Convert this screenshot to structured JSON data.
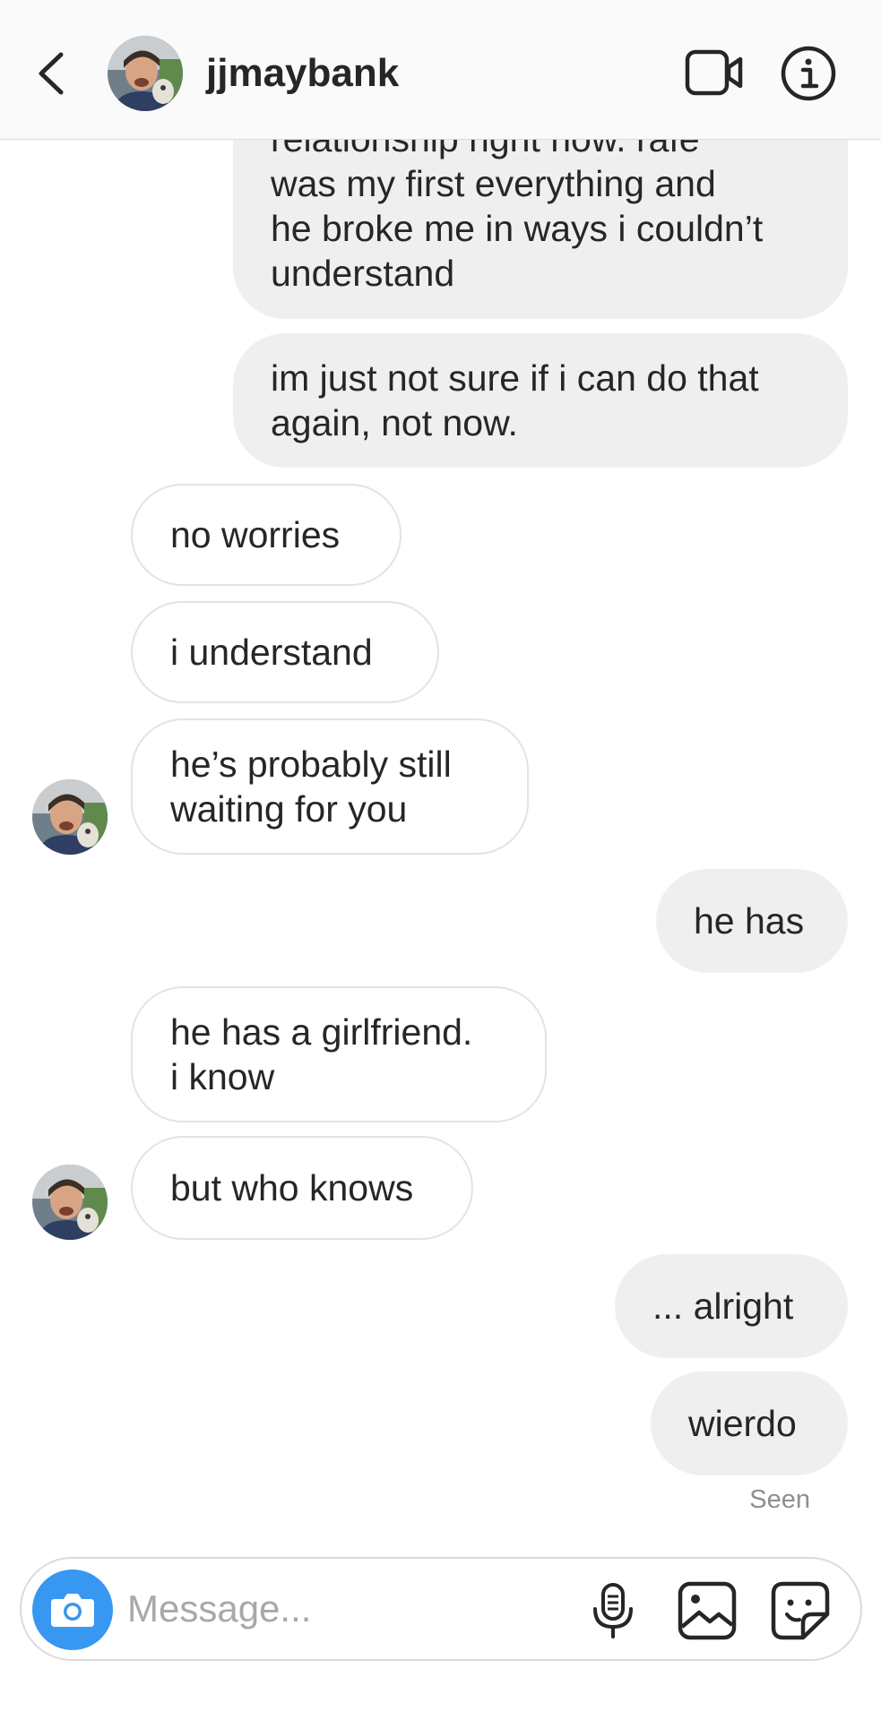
{
  "header": {
    "username": "jjmaybank",
    "icons": [
      "chevron-left-icon",
      "video-camera-icon",
      "info-icon"
    ]
  },
  "messages": [
    {
      "from": "me",
      "text": "relationship right now. rafe\nwas my first everything and\nhe broke me in ways i couldn’t\nunderstand"
    },
    {
      "from": "me",
      "text": "im just not sure if i can do that\nagain, not now."
    },
    {
      "from": "them",
      "text": "no worries"
    },
    {
      "from": "them",
      "text": "i understand"
    },
    {
      "from": "them",
      "text": "he’s probably still\nwaiting for you"
    },
    {
      "from": "me",
      "text": "he has"
    },
    {
      "from": "them",
      "text": "he has a girlfriend.\ni know"
    },
    {
      "from": "them",
      "text": "but who knows"
    },
    {
      "from": "me",
      "text": "... alright"
    },
    {
      "from": "me",
      "text": "wierdo"
    }
  ],
  "status": {
    "seen": "Seen"
  },
  "composer": {
    "placeholder": "Message...",
    "icons": [
      "camera-icon",
      "microphone-icon",
      "gallery-icon",
      "sticker-icon"
    ]
  },
  "colors": {
    "accent": "#3897f0",
    "sent_bubble": "#efefef",
    "received_border": "#e3e3e3",
    "text": "#262626",
    "muted": "#8e8e8e"
  }
}
